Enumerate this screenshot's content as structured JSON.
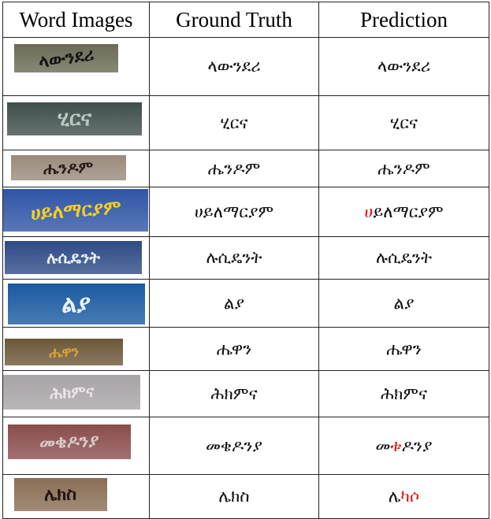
{
  "table": {
    "headers": [
      "Word Images",
      "Ground Truth",
      "Prediction"
    ],
    "rows": [
      {
        "gt": "ላውንደሪ",
        "pred": [
          {
            "t": "ላውንደሪ",
            "e": false
          }
        ],
        "image": {
          "text": "ላውንደሪ",
          "bg": "#6a6a55",
          "fg": "#141414"
        }
      },
      {
        "gt": "ሂርና",
        "pred": [
          {
            "t": "ሂርና",
            "e": false
          }
        ],
        "image": {
          "text": "ሂርና",
          "bg": "#3f4f4c",
          "fg": "#bcc7c3"
        }
      },
      {
        "gt": "ሔንዶም",
        "pred": [
          {
            "t": "ሔንዶም",
            "e": false
          }
        ],
        "image": {
          "text": "ሔንዶም",
          "bg": "#9a8a7c",
          "fg": "#2a1a16"
        }
      },
      {
        "gt": "ሀይለማርያም",
        "pred": [
          {
            "t": "ሀ",
            "e": true
          },
          {
            "t": "ይለማርያም",
            "e": false
          }
        ],
        "image": {
          "text": "ሀይለማርያም",
          "bg": "#2f55a6",
          "fg": "#f4d020"
        }
      },
      {
        "gt": "ሉሲዴንት",
        "pred": [
          {
            "t": "ሉሲዴንት",
            "e": false
          }
        ],
        "image": {
          "text": "ሉሲዴንት",
          "bg": "#2e4b86",
          "fg": "#e8eef8"
        }
      },
      {
        "gt": "ል",
        "pred": [
          {
            "t": "ል",
            "e": false
          }
        ],
        "image": {
          "text": "ልያ",
          "bg": "#1a5aa0",
          "fg": "#eaf2ff"
        }
      },
      {
        "gt": "ሔዋን",
        "pred": [
          {
            "t": "ሔዋን",
            "e": false
          }
        ],
        "image": {
          "text": "ሔዋን",
          "bg": "#6d5838",
          "fg": "#d9a13a"
        }
      },
      {
        "gt": "ሕክምና",
        "pred": [
          {
            "t": "ሕክምና",
            "e": false
          }
        ],
        "image": {
          "text": "ሕክምና",
          "bg": "#a9a4a7",
          "fg": "#eae4e8"
        }
      },
      {
        "gt": "መቄዶንያ",
        "pred": [
          {
            "t": "መ",
            "e": false
          },
          {
            "t": "ቱ",
            "e": true
          },
          {
            "t": "ዶንያ",
            "e": false
          }
        ],
        "image": {
          "text": "መቄዶንያ",
          "bg": "#8a4d4d",
          "fg": "#d8c8c8"
        }
      },
      {
        "gt": "ሌክስ",
        "pred": [
          {
            "t": "ሌ",
            "e": false
          },
          {
            "t": "ካሶ",
            "e": true
          }
        ],
        "image": {
          "text": "ሌክስ",
          "bg": "#8a6e55",
          "fg": "#241611"
        }
      }
    ]
  }
}
